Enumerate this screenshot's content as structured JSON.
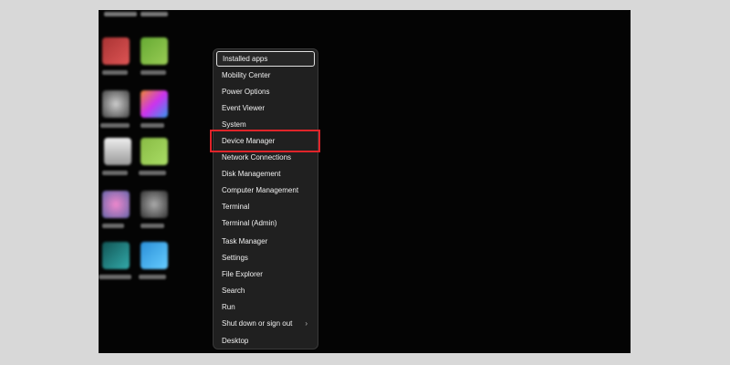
{
  "menu": {
    "items": [
      {
        "label": "Installed apps"
      },
      {
        "label": "Mobility Center"
      },
      {
        "label": "Power Options"
      },
      {
        "label": "Event Viewer"
      },
      {
        "label": "System"
      },
      {
        "label": "Device Manager"
      },
      {
        "label": "Network Connections"
      },
      {
        "label": "Disk Management"
      },
      {
        "label": "Computer Management"
      },
      {
        "label": "Terminal"
      },
      {
        "label": "Terminal (Admin)"
      },
      {
        "label": "Task Manager"
      },
      {
        "label": "Settings"
      },
      {
        "label": "File Explorer"
      },
      {
        "label": "Search"
      },
      {
        "label": "Run"
      },
      {
        "label": "Shut down or sign out",
        "chevron": "›"
      },
      {
        "label": "Desktop"
      }
    ]
  },
  "colors": {
    "page_background": "#d8d8d8",
    "desktop_background": "#040404",
    "menu_background": "#202020",
    "highlight_border": "#e0242a"
  },
  "icons": {
    "submenu_indicator": "chevron-right-icon"
  }
}
